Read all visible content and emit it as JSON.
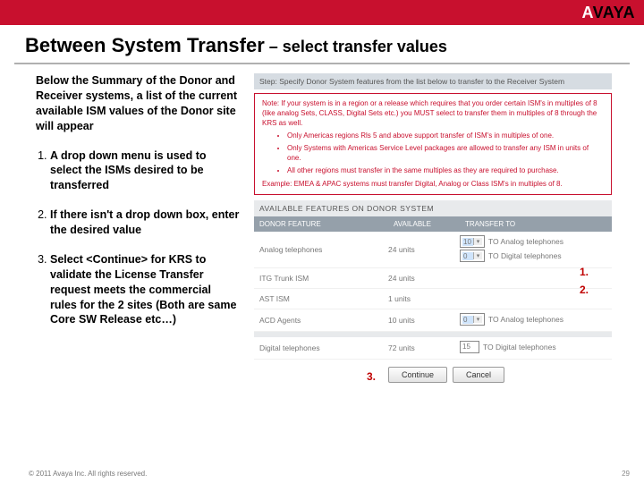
{
  "brand": {
    "name": "AVAYA"
  },
  "title": {
    "main": "Between System Transfer",
    "sub": " – select transfer values"
  },
  "intro": "Below the Summary of the Donor and Receiver systems,  a list of the current available ISM values of the Donor site will appear",
  "steps": [
    "A drop down menu is used to select the ISMs desired to be transferred",
    "If there isn't a drop down box, enter the desired value",
    "Select  <Continue> for KRS to validate the License Transfer request meets the commercial rules for the 2 sites (Both are same Core SW Release etc…)"
  ],
  "panel": {
    "step_head": "Step: Specify Donor System features from the list below to transfer to the Receiver System",
    "note_lead": "Note: If your system is in a region or a release which requires that you order certain ISM's in multiples of 8 (like analog Sets, CLASS, Digital Sets etc.) you MUST select to transfer them in multiples of 8 through the KRS as well.",
    "note_items": [
      "Only Americas regions Rls 5 and above support transfer of ISM's in multiples of one.",
      "Only Systems with Americas Service Level packages are allowed to transfer any ISM in units of one.",
      "All other regions must transfer in the same multiples as they are required to purchase."
    ],
    "note_example": "Example: EMEA & APAC systems must transfer Digital, Analog or Class ISM's in multiples of 8.",
    "avail": "AVAILABLE FEATURES ON DONOR SYSTEM",
    "headers": {
      "c1": "DONOR FEATURE",
      "c2": "AVAILABLE",
      "c3": "TRANSFER TO"
    },
    "rows": [
      {
        "feature": "Analog telephones",
        "avail": "24 units",
        "transfers": [
          {
            "type": "select",
            "value": "10",
            "label": "TO Analog telephones"
          },
          {
            "type": "select",
            "value": "0",
            "label": "TO Digital telephones"
          }
        ]
      },
      {
        "feature": "ITG Trunk ISM",
        "avail": "24 units",
        "transfers": []
      },
      {
        "feature": "AST ISM",
        "avail": "1 units",
        "transfers": []
      },
      {
        "feature": "ACD Agents",
        "avail": "10 units",
        "transfers": [
          {
            "type": "select",
            "value": "0",
            "label": "TO Analog telephones"
          }
        ]
      },
      {
        "feature": "Digital telephones",
        "avail": "72 units",
        "transfers": [
          {
            "type": "input",
            "value": "15",
            "label": "TO Digital telephones"
          }
        ]
      }
    ],
    "buttons": {
      "continue": "Continue",
      "cancel": "Cancel"
    }
  },
  "callouts": {
    "c1": "1.",
    "c2": "2.",
    "c3": "3."
  },
  "footer": {
    "copy": "© 2011 Avaya Inc. All rights reserved.",
    "page": "29"
  }
}
